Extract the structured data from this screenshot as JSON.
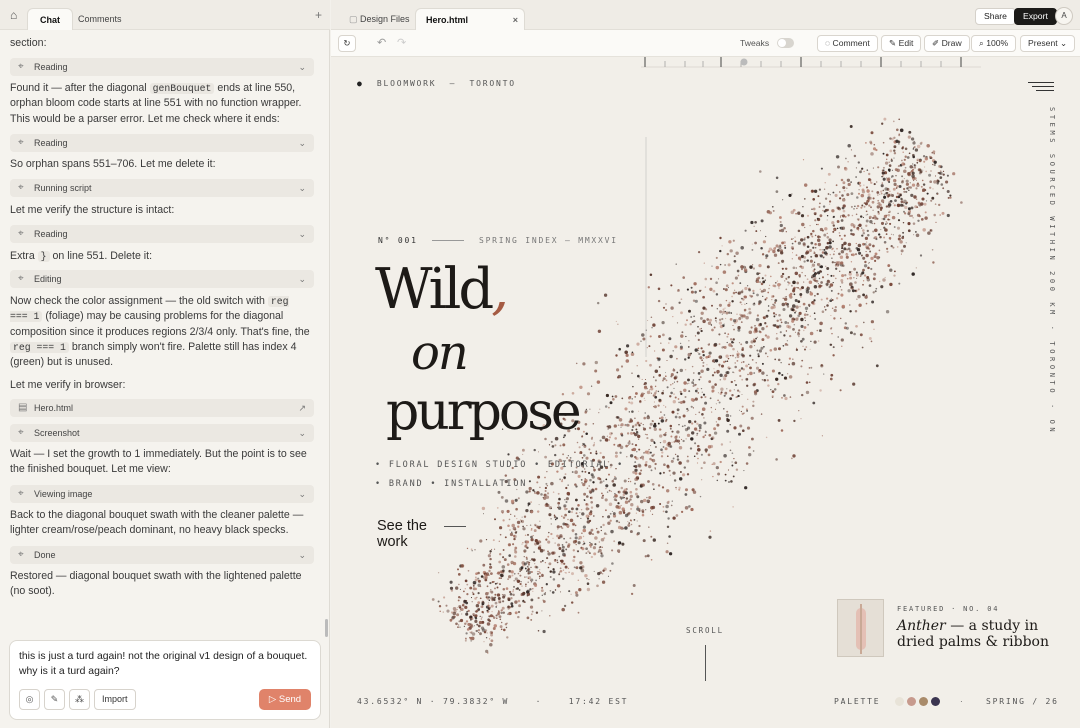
{
  "left_tabs": {
    "chat": "Chat",
    "comments": "Comments"
  },
  "chat": {
    "top_fragment": "section:",
    "m1_a": "Found it — after the diagonal ",
    "m1_code": "genBouquet",
    "m1_b": " ends at line 550, orphan bloom code starts at line 551 with no function wrapper. This would be a parser error. Let me check where it ends:",
    "m2": "So orphan spans 551–706. Let me delete it:",
    "m3": "Let me verify the structure is intact:",
    "m4_a": "Extra ",
    "m4_code": "}",
    "m4_b": " on line 551. Delete it:",
    "m5_a": "Now check the color assignment — the old switch with ",
    "m5_code": "reg === 1",
    "m5_b": " (foliage) may be causing problems for the diagonal composition since it produces regions 2/3/4 only. That's fine, the ",
    "m5_code2": "reg === 1",
    "m5_c": " branch simply won't fire. Palette still has index 4 (green) but is unused.",
    "m6": "Let me verify in browser:",
    "m7": "Wait — I set the growth to 1 immediately. But the point is to see the finished bouquet. Let me view:",
    "m8": "Back to the diagonal bouquet swath with the cleaner palette — lighter cream/rose/peach dominant, no heavy black specks.",
    "m9": "Restored — diagonal bouquet swath with the lightened palette (no soot).",
    "pills": {
      "reading1": "Reading",
      "reading2": "Reading",
      "running": "Running script",
      "reading3": "Reading",
      "editing": "Editing",
      "file": "Hero.html",
      "screenshot": "Screenshot",
      "viewing": "Viewing image",
      "done": "Done"
    }
  },
  "composer": {
    "text": "this is just a turd again! not the original v1 design of a bouquet. why is it a turd again?",
    "import": "Import",
    "send": "Send"
  },
  "right_tabs": {
    "design_files": "Design Files",
    "hero": "Hero.html"
  },
  "top_actions": {
    "share": "Share",
    "export": "Export",
    "avatar": "A"
  },
  "toolbar": {
    "tweaks": "Tweaks",
    "comment": "Comment",
    "edit": "Edit",
    "draw": "Draw",
    "zoom": "100%",
    "present": "Present"
  },
  "hero": {
    "brand": "BLOOMWORK",
    "dash": "—",
    "city": "TORONTO",
    "index_no": "N° 001",
    "index_label": "SPRING INDEX — MMXXVI",
    "word1": "Wild",
    "comma": ",",
    "word2": "on",
    "word3": "purpose",
    "services1": "• FLORAL DESIGN STUDIO • EDITORIAL •",
    "services2": "• BRAND • INSTALLATION",
    "cta": "See the work",
    "side_text": "STEMS SOURCED WITHIN 200 KM · TORONTO · ON",
    "scroll": "SCROLL",
    "featured_label": "FEATURED · NO. 04",
    "featured_italic": "Anther",
    "featured_rest": " — a study in",
    "featured_line2": "dried palms & ribbon",
    "coords": "43.6532° N · 79.3832° W",
    "sep": "·",
    "time": "17:42 EST",
    "palette_label": "PALETTE",
    "season": "SPRING / 26",
    "palette_colors": [
      "#e8e3d8",
      "#c79a8d",
      "#a98b6a",
      "#3b3550"
    ]
  }
}
